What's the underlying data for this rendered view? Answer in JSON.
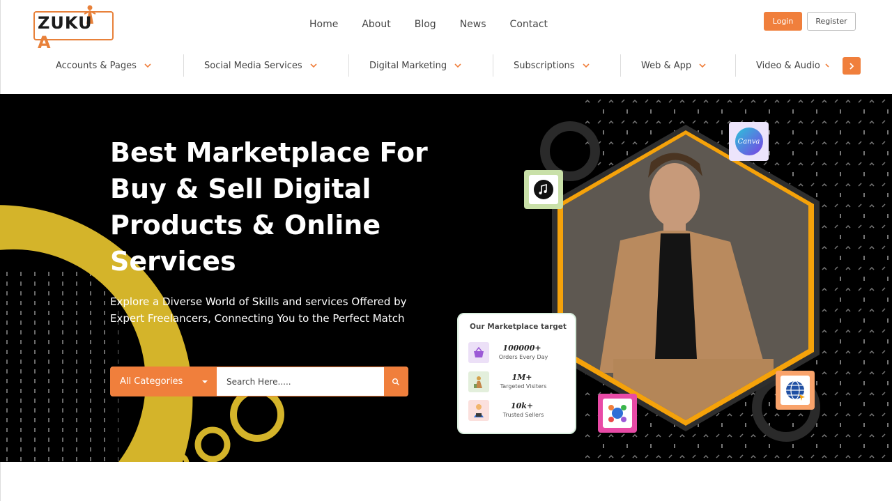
{
  "brand": {
    "logo_text_a": "ZUKU",
    "logo_text_b": "A",
    "accent": "#f07f3c",
    "gold": "#d4b42a",
    "hex_orange": "#f5a20a"
  },
  "topnav": [
    "Home",
    "About",
    "Blog",
    "News",
    "Contact"
  ],
  "auth": {
    "login": "Login",
    "register": "Register"
  },
  "categories": [
    "Accounts & Pages",
    "Social Media Services",
    "Digital Marketing",
    "Subscriptions",
    "Web & App",
    "Video & Audio"
  ],
  "hero": {
    "title": "Best Marketplace For Buy & Sell Digital Products & Online Services",
    "subtitle": "Explore a Diverse World of Skills and services Offered by Expert Freelancers, Connecting You to the Perfect Match"
  },
  "search": {
    "category": "All Categories",
    "placeholder": "Search Here....."
  },
  "target_card": {
    "title": "Our Marketplace target",
    "stats": [
      {
        "value": "100000+",
        "label": "Orders Every Day",
        "icon": "basket-icon"
      },
      {
        "value": "1M+",
        "label": "Targeted Visiters",
        "icon": "visitors-icon"
      },
      {
        "value": "10k+",
        "label": "Trusted Sellers",
        "icon": "sellers-icon"
      }
    ]
  },
  "apps": {
    "canva": "Canva"
  }
}
